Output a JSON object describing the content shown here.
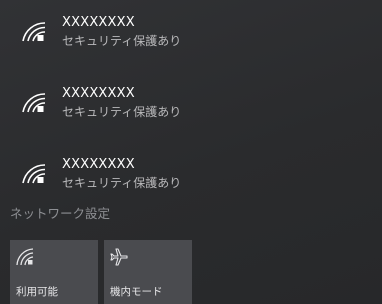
{
  "networks": [
    {
      "ssid": "XXXXXXXX",
      "status": "セキュリティ保護あり",
      "icon": "wifi-icon"
    },
    {
      "ssid": "XXXXXXXX",
      "status": "セキュリティ保護あり",
      "icon": "wifi-icon"
    },
    {
      "ssid": "XXXXXXXX",
      "status": "セキュリティ保護あり",
      "icon": "wifi-icon"
    }
  ],
  "settings_link": "ネットワーク設定",
  "quick_actions": [
    {
      "label": "利用可能",
      "icon": "wifi-icon"
    },
    {
      "label": "機内モード",
      "icon": "airplane-icon"
    }
  ],
  "colors": {
    "background": "#2a2b2e",
    "tile": "#4a4b4f",
    "muted_text": "#8d8f93"
  }
}
